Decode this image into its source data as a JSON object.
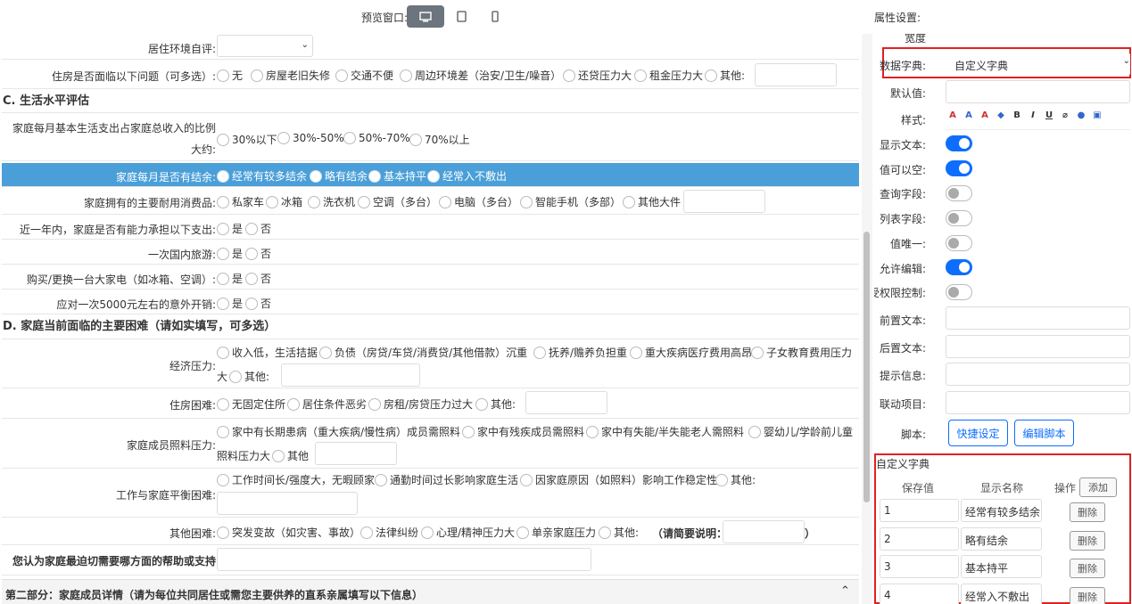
{
  "topbar": {
    "preview_label": "预览窗口:",
    "devices": [
      "desktop-icon",
      "tablet-icon",
      "mobile-icon"
    ],
    "props_title": "属性设置:"
  },
  "form": {
    "r1": {
      "label": "居住环境自评:"
    },
    "r2": {
      "label": "住房是否面临以下问题（可多选）:",
      "options": [
        "无",
        "房屋老旧失修",
        "交通不便",
        "周边环境差（治安/卫生/噪音）",
        "还贷压力大",
        "租金压力大",
        "其他:"
      ]
    },
    "secC": "C. 生活水平评估",
    "r3": {
      "label1": "家庭每月基本生活支出占家庭总收入的比例",
      "label2": "大约:",
      "options": [
        "30%以下",
        "30%-50%",
        "50%-70%",
        "70%以上"
      ]
    },
    "r4": {
      "label": "家庭每月是否有结余:",
      "options": [
        "经常有较多结余",
        "略有结余",
        "基本持平",
        "经常入不敷出"
      ]
    },
    "r5": {
      "label": "家庭拥有的主要耐用消费品:",
      "options": [
        "私家车",
        "冰箱",
        "洗衣机",
        "空调（多台）",
        "电脑（多台）",
        "智能手机（多部）",
        "其他大件"
      ]
    },
    "r6": {
      "label": "近一年内，家庭是否有能力承担以下支出:",
      "options": [
        "是",
        "否"
      ]
    },
    "r7": {
      "label": "一次国内旅游:",
      "options": [
        "是",
        "否"
      ]
    },
    "r8": {
      "label": "购买/更换一台大家电（如冰箱、空调）:",
      "options": [
        "是",
        "否"
      ]
    },
    "r9": {
      "label": "应对一次5000元左右的意外开销:",
      "options": [
        "是",
        "否"
      ]
    },
    "secD": "D. 家庭当前面临的主要困难（请如实填写，可多选）",
    "r10": {
      "label": "经济压力:",
      "options": [
        "收入低，生活拮据",
        "负债（房贷/车贷/消费贷/其他借款）沉重",
        "抚养/赡养负担重",
        "重大疾病医疗费用高昂",
        "子女教育费用压力"
      ],
      "line2a": "大",
      "line2b": "其他:"
    },
    "r11": {
      "label": "住房困难:",
      "options": [
        "无固定住所",
        "居住条件恶劣",
        "房租/房贷压力过大",
        "其他:"
      ]
    },
    "r12": {
      "label": "家庭成员照料压力:",
      "options": [
        "家中有长期患病（重大疾病/慢性病）成员需照料",
        "家中有残疾成员需照料",
        "家中有失能/半失能老人需照料",
        "婴幼儿/学龄前儿童"
      ],
      "line2": "照料压力大",
      "other": "其他"
    },
    "r13": {
      "label": "工作与家庭平衡困难:",
      "options": [
        "工作时间长/强度大，无暇顾家",
        "通勤时间过长影响家庭生活",
        "因家庭原因（如照料）影响工作稳定性",
        "其他:"
      ]
    },
    "r14": {
      "label": "其他困难:",
      "options": [
        "突发变故（如灾害、事故）",
        "法律纠纷",
        "心理/精神压力大",
        "单亲家庭压力",
        "其他:"
      ],
      "note": "（请简要说明：",
      "close": "）"
    },
    "r15": {
      "label": "您认为家庭最迫切需要哪方面的帮助或支持:"
    },
    "part2": "第二部分：家庭成员详情（请为每位共同居住或需您主要供养的直系亲属填写以下信息）"
  },
  "props": {
    "width_label": "宽度",
    "dict_label": "数据字典:",
    "dict_value": "自定义字典",
    "default_label": "默认值:",
    "style_label": "样式:",
    "show_text_label": "显示文本:",
    "show_text": true,
    "nullable_label": "值可以空:",
    "nullable": true,
    "query_label": "查询字段:",
    "query": false,
    "list_label": "列表字段:",
    "list": false,
    "unique_label": "值唯一:",
    "unique": false,
    "edit_label": "允许编辑:",
    "edit": true,
    "auth_label": "受权限控制:",
    "auth": false,
    "prefix_label": "前置文本:",
    "suffix_label": "后置文本:",
    "hint_label": "提示信息:",
    "link_label": "联动项目:",
    "script_label": "脚本:",
    "quick_btn": "快捷设定",
    "edit_script_btn": "编辑脚本",
    "custom_dict_title": "自定义字典",
    "col_value": "保存值",
    "col_name": "显示名称",
    "col_op": "操作",
    "add_btn": "添加",
    "dict_rows": [
      {
        "value": "1",
        "name": "经常有较多结余",
        "del": "删除"
      },
      {
        "value": "2",
        "name": "略有结余",
        "del": "删除"
      },
      {
        "value": "3",
        "name": "基本持平",
        "del": "删除"
      },
      {
        "value": "4",
        "name": "经常入不敷出",
        "del": "删除"
      }
    ]
  },
  "colors": {
    "highlight": "#4a9fd8",
    "accent": "#0d6efd",
    "red": "#e02020"
  }
}
